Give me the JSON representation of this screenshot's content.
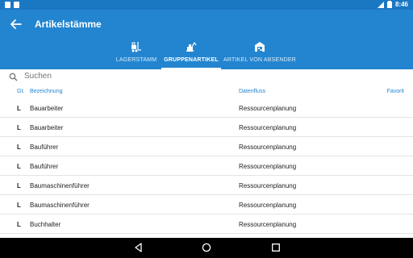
{
  "status_bar": {
    "time": "8:46"
  },
  "app_bar": {
    "title": "Artikelstämme"
  },
  "tabs": [
    {
      "label": "LAGERSTAMM",
      "icon": "forklift-icon",
      "active": false
    },
    {
      "label": "GRUPPENARTIKEL",
      "icon": "excavator-icon",
      "active": true
    },
    {
      "label": "ARTIKEL VON ABSENDER",
      "icon": "warehouse-icon",
      "active": false
    }
  ],
  "search": {
    "placeholder": "Suchen"
  },
  "table": {
    "columns": [
      "Gt.",
      "Bezeichnung",
      "Datenfluss",
      "Favorit"
    ],
    "rows": [
      {
        "gt": "L",
        "bezeichnung": "Bauarbeiter",
        "datenfluss": "Ressourcenplanung"
      },
      {
        "gt": "L",
        "bezeichnung": "Bauarbeiter",
        "datenfluss": "Ressourcenplanung"
      },
      {
        "gt": "L",
        "bezeichnung": "Bauführer",
        "datenfluss": "Ressourcenplanung"
      },
      {
        "gt": "L",
        "bezeichnung": "Bauführer",
        "datenfluss": "Ressourcenplanung"
      },
      {
        "gt": "L",
        "bezeichnung": "Baumaschinenführer",
        "datenfluss": "Ressourcenplanung"
      },
      {
        "gt": "L",
        "bezeichnung": "Baumaschinenführer",
        "datenfluss": "Ressourcenplanung"
      },
      {
        "gt": "L",
        "bezeichnung": "Buchhalter",
        "datenfluss": "Ressourcenplanung"
      }
    ]
  },
  "colors": {
    "app_bar": "#2385d0",
    "status_bar": "#1a77c2",
    "accent": "#2385d0"
  }
}
